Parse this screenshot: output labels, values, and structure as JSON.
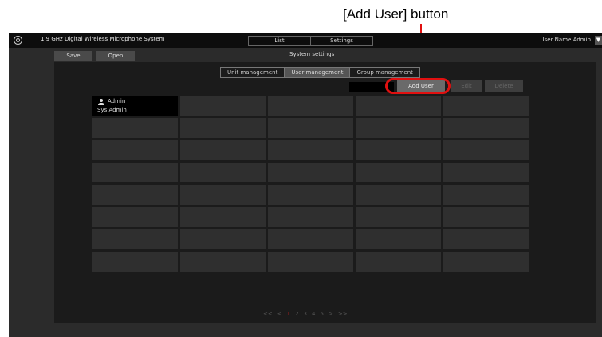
{
  "callout": {
    "label": "[Add User] button"
  },
  "app": {
    "title": "1.9 GHz Digital Wireless Microphone System",
    "user_name": "User Name:Admin"
  },
  "topnav": {
    "list": "List",
    "settings": "Settings"
  },
  "toolbar": {
    "save": "Save",
    "open": "Open",
    "heading": "System settings"
  },
  "tabs": {
    "unit": "Unit management",
    "user": "User management",
    "group": "Group management"
  },
  "actions": {
    "add_user": "Add User",
    "edit": "Edit",
    "delete": "Delete"
  },
  "users": [
    {
      "name": "Admin",
      "role": "Sys Admin"
    }
  ],
  "pager": {
    "first": "<<",
    "prev": "<",
    "pages": [
      "1",
      "2",
      "3",
      "4",
      "5"
    ],
    "next": ">",
    "last": ">>"
  },
  "colors": {
    "callout": "#e01010",
    "background": "#2b2b2b",
    "panel": "#1b1b1b"
  }
}
